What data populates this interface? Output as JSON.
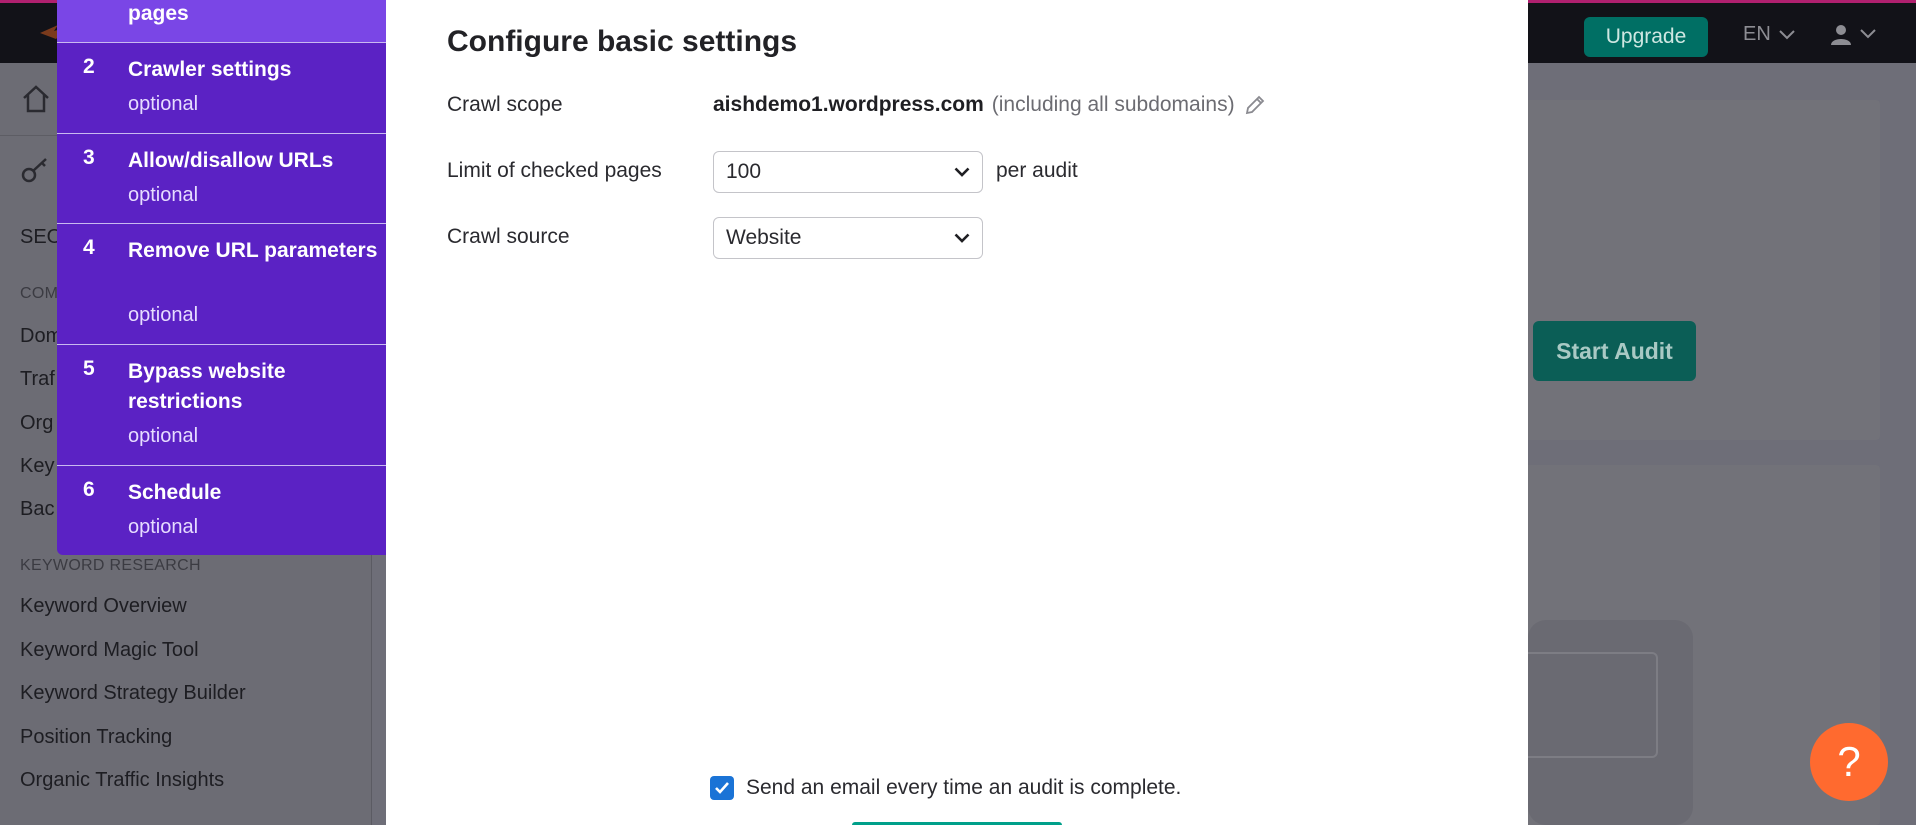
{
  "topbar": {
    "upgrade_label": "Upgrade",
    "language": "EN"
  },
  "sidebar": {
    "items_partial": [
      {
        "label": "SEO"
      },
      {
        "label": "Dom"
      },
      {
        "label": "Traf"
      },
      {
        "label": "Org"
      },
      {
        "label": "Key"
      },
      {
        "label": "Bac"
      }
    ],
    "section_competitive": "COM",
    "section_keyword_research": "KEYWORD RESEARCH",
    "keyword_items": [
      {
        "label": "Keyword Overview"
      },
      {
        "label": "Keyword Magic Tool"
      },
      {
        "label": "Keyword Strategy Builder"
      },
      {
        "label": "Position Tracking"
      },
      {
        "label": "Organic Traffic Insights"
      }
    ]
  },
  "background": {
    "start_audit_label": "Start Audit"
  },
  "steps": {
    "top_label": "pages",
    "items": [
      {
        "num": "2",
        "title": "Crawler settings",
        "sub": "optional"
      },
      {
        "num": "3",
        "title": "Allow/disallow URLs",
        "sub": "optional"
      },
      {
        "num": "4",
        "title": "Remove URL parameters",
        "sub": "optional"
      },
      {
        "num": "5",
        "title": "Bypass website restrictions",
        "sub": "optional"
      },
      {
        "num": "6",
        "title": "Schedule",
        "sub": "optional"
      }
    ]
  },
  "modal": {
    "title": "Configure basic settings",
    "crawl_scope_label": "Crawl scope",
    "crawl_scope_domain": "aishdemo1.wordpress.com",
    "crawl_scope_note": "(including all subdomains)",
    "limit_label": "Limit of checked pages",
    "limit_value": "100",
    "per_audit": "per audit",
    "source_label": "Crawl source",
    "source_value": "Website",
    "email_label": "Send an email every time an audit is complete.",
    "email_checked": true
  },
  "help": {
    "label": "?"
  },
  "colors": {
    "steps_bg": "#5b22c4",
    "steps_active": "#7a46e6",
    "accent_teal": "#00a08a",
    "checkbox_blue": "#1a73d6",
    "help_orange": "#ff6a2f",
    "topbar_border": "#b0206f"
  }
}
